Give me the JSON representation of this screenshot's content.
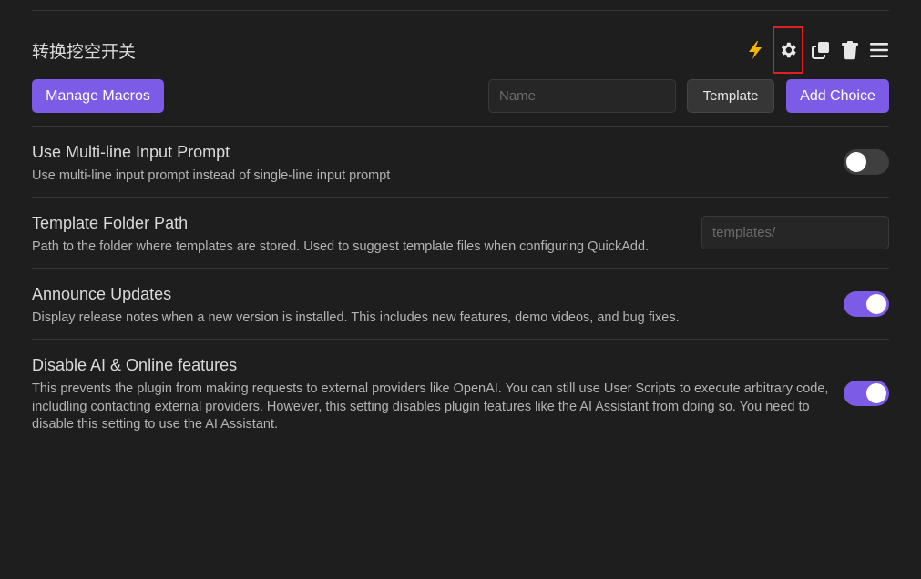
{
  "choice": {
    "name": "转换挖空开关",
    "icons": [
      "lightning-icon",
      "gear-icon",
      "duplicate-icon",
      "trash-icon",
      "menu-icon"
    ]
  },
  "toolbar": {
    "manage_macros_label": "Manage Macros",
    "name_placeholder": "Name",
    "template_label": "Template",
    "add_choice_label": "Add Choice"
  },
  "settings": {
    "multiline": {
      "name": "Use Multi-line Input Prompt",
      "desc": "Use multi-line input prompt instead of single-line input prompt",
      "enabled": false
    },
    "template_folder": {
      "name": "Template Folder Path",
      "desc": "Path to the folder where templates are stored. Used to suggest template files when configuring QuickAdd.",
      "placeholder": "templates/"
    },
    "announce": {
      "name": "Announce Updates",
      "desc": "Display release notes when a new version is installed. This includes new features, demo videos, and bug fixes.",
      "enabled": true
    },
    "disable_ai": {
      "name": "Disable AI & Online features",
      "desc": "This prevents the plugin from making requests to external providers like OpenAI. You can still use User Scripts to execute arbitrary code, includling contacting external providers. However, this setting disables plugin features like the AI Assistant from doing so. You need to disable this setting to use the AI Assistant.",
      "enabled": true
    }
  },
  "colors": {
    "accent": "#7c5ce6",
    "lightning": "#f5b700",
    "highlight_box": "#e02020",
    "background": "#1e1e1e"
  }
}
